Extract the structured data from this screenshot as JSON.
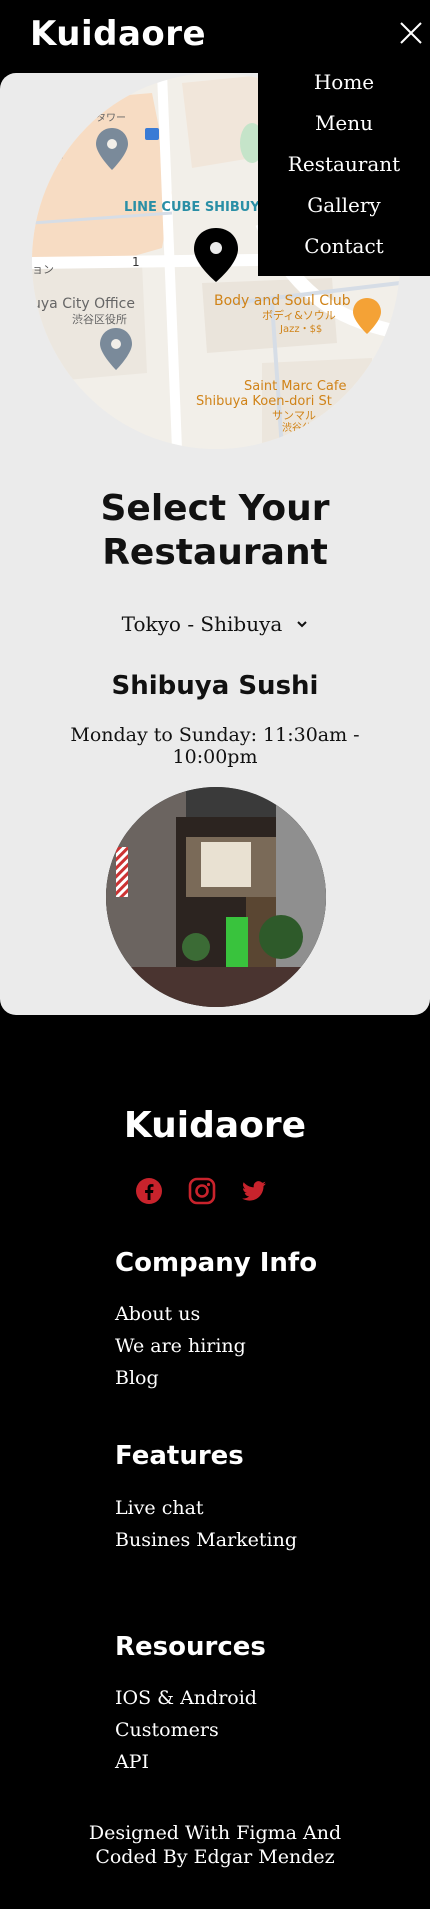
{
  "header": {
    "brand": "Kuidaore",
    "close_icon": "close-icon"
  },
  "nav": {
    "items": [
      "Home",
      "Menu",
      "Restaurant",
      "Gallery",
      "Contact"
    ]
  },
  "map": {
    "labels": {
      "tower": "タワー",
      "venue": "LINE CUBE SHIBUYA",
      "block_number": "1",
      "jp_fragment": "ョン",
      "office_en": "uya City Office",
      "office_jp": "渋谷区役所",
      "club_en": "Body and Soul Club",
      "club_jp": "ボディ&ソウル",
      "club_meta": "Jazz・$$",
      "cafe_en_1": "Saint Marc Cafe",
      "cafe_en_2": "Shibuya Koen-dori St",
      "cafe_jp_1": "サンマル",
      "cafe_jp_2": "渋谷公"
    }
  },
  "main": {
    "title_line1": "Select Your",
    "title_line2": "Restaurant",
    "location_select": "Tokyo - Shibuya",
    "restaurant_name": "Shibuya Sushi",
    "hours_line1": "Monday to Sunday: 11:30am -",
    "hours_line2": "10:00pm"
  },
  "footer": {
    "brand": "Kuidaore",
    "social": [
      "facebook-icon",
      "instagram-icon",
      "twitter-icon"
    ],
    "accent_color": "#c8232c",
    "company_title": "Company Info",
    "company_links": [
      "About us",
      "We are hiring",
      "Blog"
    ],
    "features_title": "Features",
    "features_links": [
      "Live chat",
      "Busines Marketing"
    ],
    "resources_title": "Resources",
    "resources_links": [
      "IOS & Android",
      "Customers",
      "API"
    ],
    "credit_line1": "Designed With Figma And",
    "credit_line2": "Coded By Edgar Mendez"
  }
}
